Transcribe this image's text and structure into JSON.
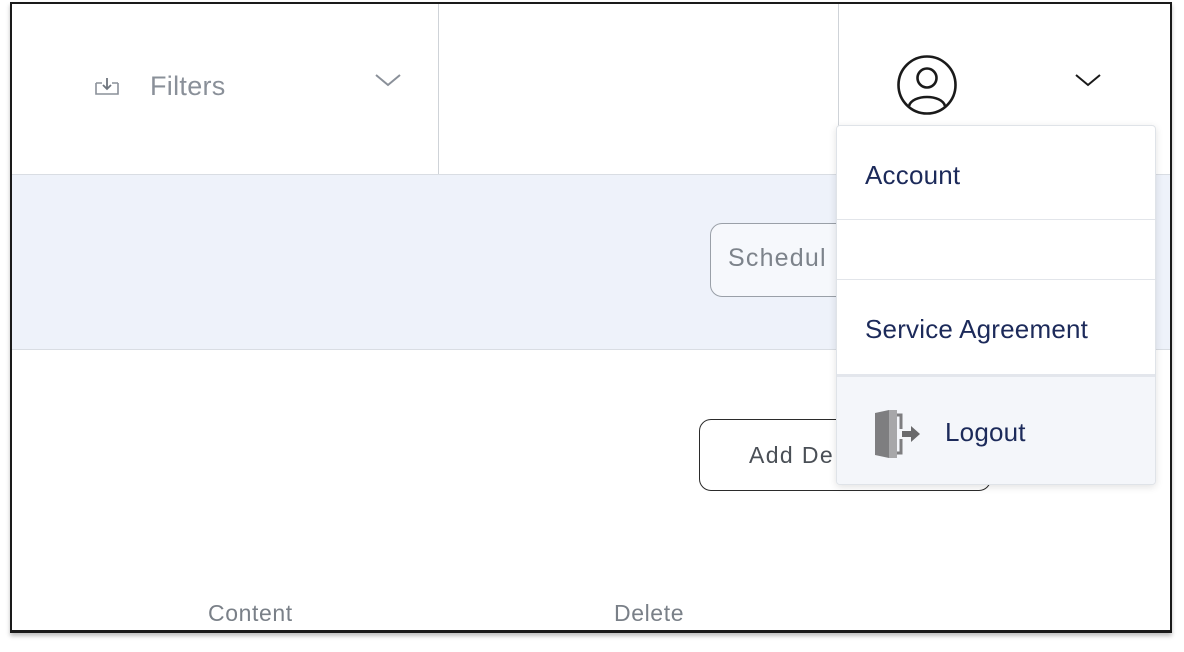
{
  "header": {
    "filters_label": "Filters",
    "user_menu": {
      "items": [
        {
          "label": "Account"
        },
        {
          "label": ""
        },
        {
          "label": "Service Agreement"
        },
        {
          "label": "Logout"
        }
      ]
    }
  },
  "toolbar": {
    "schedule_placeholder": "Schedul"
  },
  "actions": {
    "add_label": "Add De"
  },
  "table": {
    "columns": [
      "Content",
      "Delete"
    ]
  },
  "icons": {
    "filters": "download-tray-icon",
    "filters_toggle": "chevron-down-icon",
    "user": "user-circle-icon",
    "user_toggle": "chevron-down-icon",
    "logout": "door-exit-icon"
  },
  "colors": {
    "band_bg": "#eef2fa",
    "menu_text": "#1c2a5a",
    "muted_text": "#8a9099"
  }
}
